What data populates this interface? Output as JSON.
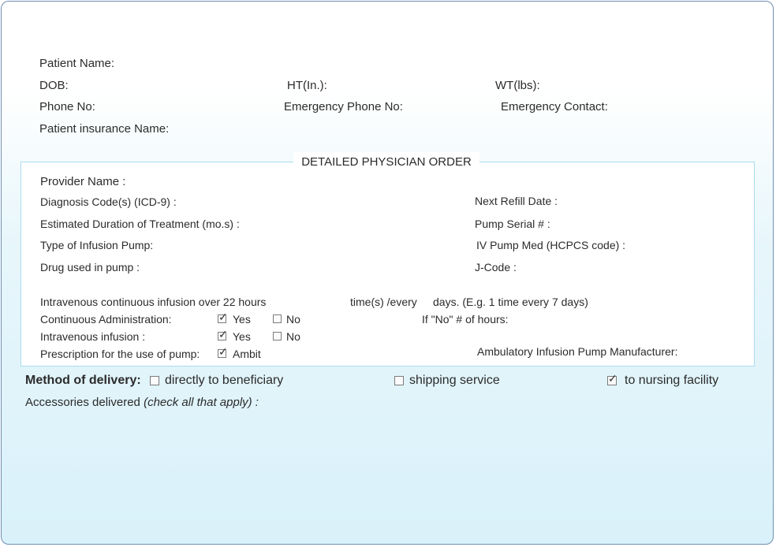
{
  "patient": {
    "name_label": "Patient Name:",
    "dob_label": "DOB:",
    "ht_label": "HT(In.):",
    "wt_label": "WT(lbs):",
    "phone_label": "Phone No:",
    "emergency_phone_label": "Emergency Phone No:",
    "emergency_contact_label": "Emergency Contact:",
    "insurance_label": "Patient insurance Name:"
  },
  "order": {
    "title": "DETAILED PHYSICIAN ORDER",
    "provider_label": "Provider Name :",
    "diagnosis_label": "Diagnosis Code(s) (ICD-9) :",
    "next_refill_label": "Next Refill Date :",
    "duration_label": "Estimated Duration of Treatment (mo.s) :",
    "pump_serial_label": "Pump Serial # :",
    "pump_type_label": "Type of Infusion Pump:",
    "iv_pump_med_label": "IV Pump Med (HCPCS code) :",
    "drug_label": "Drug used in pump :",
    "jcode_label": "J-Code :",
    "infusion_label": "Intravenous continuous infusion over 22 hours",
    "times_every_label": "time(s) /every",
    "days_example_label": "days. (E.g. 1 time every 7 days)",
    "continuous_admin_label": "Continuous Administration:",
    "if_no_hours_label": "If \"No\" # of hours:",
    "iv_infusion_label": "Intravenous infusion :",
    "prescription_label": "Prescription for the use of pump:",
    "manufacturer_label": "Ambulatory Infusion Pump Manufacturer:",
    "yes_label": "Yes",
    "no_label": "No",
    "ambit_label": "Ambit",
    "continuous_admin_yes": true,
    "continuous_admin_no": false,
    "iv_infusion_yes": true,
    "iv_infusion_no": false,
    "prescription_ambit": true
  },
  "delivery": {
    "method_label": "Method of delivery:",
    "option_beneficiary": "directly to beneficiary",
    "option_shipping": "shipping service",
    "option_nursing": "to nursing facility",
    "beneficiary_checked": false,
    "shipping_checked": false,
    "nursing_checked": true,
    "accessories_label": "Accessories delivered",
    "accessories_hint": "(check all that apply) :"
  },
  "check_glyph": "✓"
}
